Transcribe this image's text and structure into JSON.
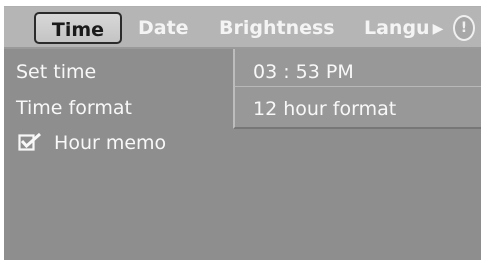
{
  "tabs": {
    "time": "Time",
    "date": "Date",
    "brightness": "Brightness",
    "language": "Langu",
    "scroll_icon": "triangle-right",
    "info_icon": "info"
  },
  "menu": {
    "set_time": "Set time",
    "time_format": "Time format",
    "hour_memo": "Hour memo",
    "hour_memo_checked": true
  },
  "values": {
    "time": "03 : 53 PM",
    "format": "12 hour format"
  }
}
